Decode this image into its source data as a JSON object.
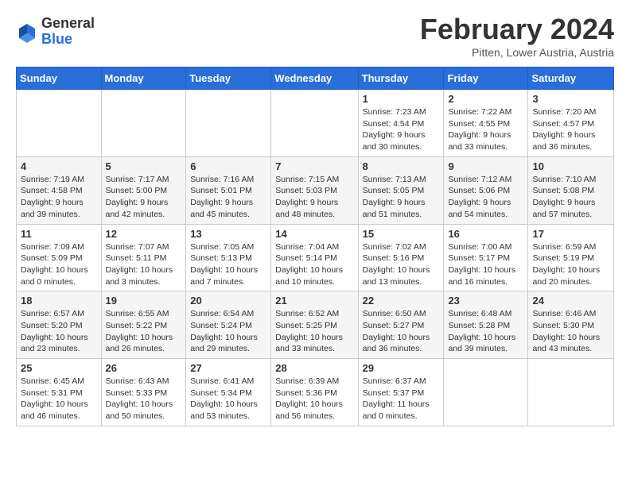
{
  "header": {
    "logo_general": "General",
    "logo_blue": "Blue",
    "month_title": "February 2024",
    "location": "Pitten, Lower Austria, Austria"
  },
  "weekdays": [
    "Sunday",
    "Monday",
    "Tuesday",
    "Wednesday",
    "Thursday",
    "Friday",
    "Saturday"
  ],
  "weeks": [
    [
      {
        "day": "",
        "sunrise": "",
        "sunset": "",
        "daylight": ""
      },
      {
        "day": "",
        "sunrise": "",
        "sunset": "",
        "daylight": ""
      },
      {
        "day": "",
        "sunrise": "",
        "sunset": "",
        "daylight": ""
      },
      {
        "day": "",
        "sunrise": "",
        "sunset": "",
        "daylight": ""
      },
      {
        "day": "1",
        "sunrise": "Sunrise: 7:23 AM",
        "sunset": "Sunset: 4:54 PM",
        "daylight": "Daylight: 9 hours and 30 minutes."
      },
      {
        "day": "2",
        "sunrise": "Sunrise: 7:22 AM",
        "sunset": "Sunset: 4:55 PM",
        "daylight": "Daylight: 9 hours and 33 minutes."
      },
      {
        "day": "3",
        "sunrise": "Sunrise: 7:20 AM",
        "sunset": "Sunset: 4:57 PM",
        "daylight": "Daylight: 9 hours and 36 minutes."
      }
    ],
    [
      {
        "day": "4",
        "sunrise": "Sunrise: 7:19 AM",
        "sunset": "Sunset: 4:58 PM",
        "daylight": "Daylight: 9 hours and 39 minutes."
      },
      {
        "day": "5",
        "sunrise": "Sunrise: 7:17 AM",
        "sunset": "Sunset: 5:00 PM",
        "daylight": "Daylight: 9 hours and 42 minutes."
      },
      {
        "day": "6",
        "sunrise": "Sunrise: 7:16 AM",
        "sunset": "Sunset: 5:01 PM",
        "daylight": "Daylight: 9 hours and 45 minutes."
      },
      {
        "day": "7",
        "sunrise": "Sunrise: 7:15 AM",
        "sunset": "Sunset: 5:03 PM",
        "daylight": "Daylight: 9 hours and 48 minutes."
      },
      {
        "day": "8",
        "sunrise": "Sunrise: 7:13 AM",
        "sunset": "Sunset: 5:05 PM",
        "daylight": "Daylight: 9 hours and 51 minutes."
      },
      {
        "day": "9",
        "sunrise": "Sunrise: 7:12 AM",
        "sunset": "Sunset: 5:06 PM",
        "daylight": "Daylight: 9 hours and 54 minutes."
      },
      {
        "day": "10",
        "sunrise": "Sunrise: 7:10 AM",
        "sunset": "Sunset: 5:08 PM",
        "daylight": "Daylight: 9 hours and 57 minutes."
      }
    ],
    [
      {
        "day": "11",
        "sunrise": "Sunrise: 7:09 AM",
        "sunset": "Sunset: 5:09 PM",
        "daylight": "Daylight: 10 hours and 0 minutes."
      },
      {
        "day": "12",
        "sunrise": "Sunrise: 7:07 AM",
        "sunset": "Sunset: 5:11 PM",
        "daylight": "Daylight: 10 hours and 3 minutes."
      },
      {
        "day": "13",
        "sunrise": "Sunrise: 7:05 AM",
        "sunset": "Sunset: 5:13 PM",
        "daylight": "Daylight: 10 hours and 7 minutes."
      },
      {
        "day": "14",
        "sunrise": "Sunrise: 7:04 AM",
        "sunset": "Sunset: 5:14 PM",
        "daylight": "Daylight: 10 hours and 10 minutes."
      },
      {
        "day": "15",
        "sunrise": "Sunrise: 7:02 AM",
        "sunset": "Sunset: 5:16 PM",
        "daylight": "Daylight: 10 hours and 13 minutes."
      },
      {
        "day": "16",
        "sunrise": "Sunrise: 7:00 AM",
        "sunset": "Sunset: 5:17 PM",
        "daylight": "Daylight: 10 hours and 16 minutes."
      },
      {
        "day": "17",
        "sunrise": "Sunrise: 6:59 AM",
        "sunset": "Sunset: 5:19 PM",
        "daylight": "Daylight: 10 hours and 20 minutes."
      }
    ],
    [
      {
        "day": "18",
        "sunrise": "Sunrise: 6:57 AM",
        "sunset": "Sunset: 5:20 PM",
        "daylight": "Daylight: 10 hours and 23 minutes."
      },
      {
        "day": "19",
        "sunrise": "Sunrise: 6:55 AM",
        "sunset": "Sunset: 5:22 PM",
        "daylight": "Daylight: 10 hours and 26 minutes."
      },
      {
        "day": "20",
        "sunrise": "Sunrise: 6:54 AM",
        "sunset": "Sunset: 5:24 PM",
        "daylight": "Daylight: 10 hours and 29 minutes."
      },
      {
        "day": "21",
        "sunrise": "Sunrise: 6:52 AM",
        "sunset": "Sunset: 5:25 PM",
        "daylight": "Daylight: 10 hours and 33 minutes."
      },
      {
        "day": "22",
        "sunrise": "Sunrise: 6:50 AM",
        "sunset": "Sunset: 5:27 PM",
        "daylight": "Daylight: 10 hours and 36 minutes."
      },
      {
        "day": "23",
        "sunrise": "Sunrise: 6:48 AM",
        "sunset": "Sunset: 5:28 PM",
        "daylight": "Daylight: 10 hours and 39 minutes."
      },
      {
        "day": "24",
        "sunrise": "Sunrise: 6:46 AM",
        "sunset": "Sunset: 5:30 PM",
        "daylight": "Daylight: 10 hours and 43 minutes."
      }
    ],
    [
      {
        "day": "25",
        "sunrise": "Sunrise: 6:45 AM",
        "sunset": "Sunset: 5:31 PM",
        "daylight": "Daylight: 10 hours and 46 minutes."
      },
      {
        "day": "26",
        "sunrise": "Sunrise: 6:43 AM",
        "sunset": "Sunset: 5:33 PM",
        "daylight": "Daylight: 10 hours and 50 minutes."
      },
      {
        "day": "27",
        "sunrise": "Sunrise: 6:41 AM",
        "sunset": "Sunset: 5:34 PM",
        "daylight": "Daylight: 10 hours and 53 minutes."
      },
      {
        "day": "28",
        "sunrise": "Sunrise: 6:39 AM",
        "sunset": "Sunset: 5:36 PM",
        "daylight": "Daylight: 10 hours and 56 minutes."
      },
      {
        "day": "29",
        "sunrise": "Sunrise: 6:37 AM",
        "sunset": "Sunset: 5:37 PM",
        "daylight": "Daylight: 11 hours and 0 minutes."
      },
      {
        "day": "",
        "sunrise": "",
        "sunset": "",
        "daylight": ""
      },
      {
        "day": "",
        "sunrise": "",
        "sunset": "",
        "daylight": ""
      }
    ]
  ]
}
